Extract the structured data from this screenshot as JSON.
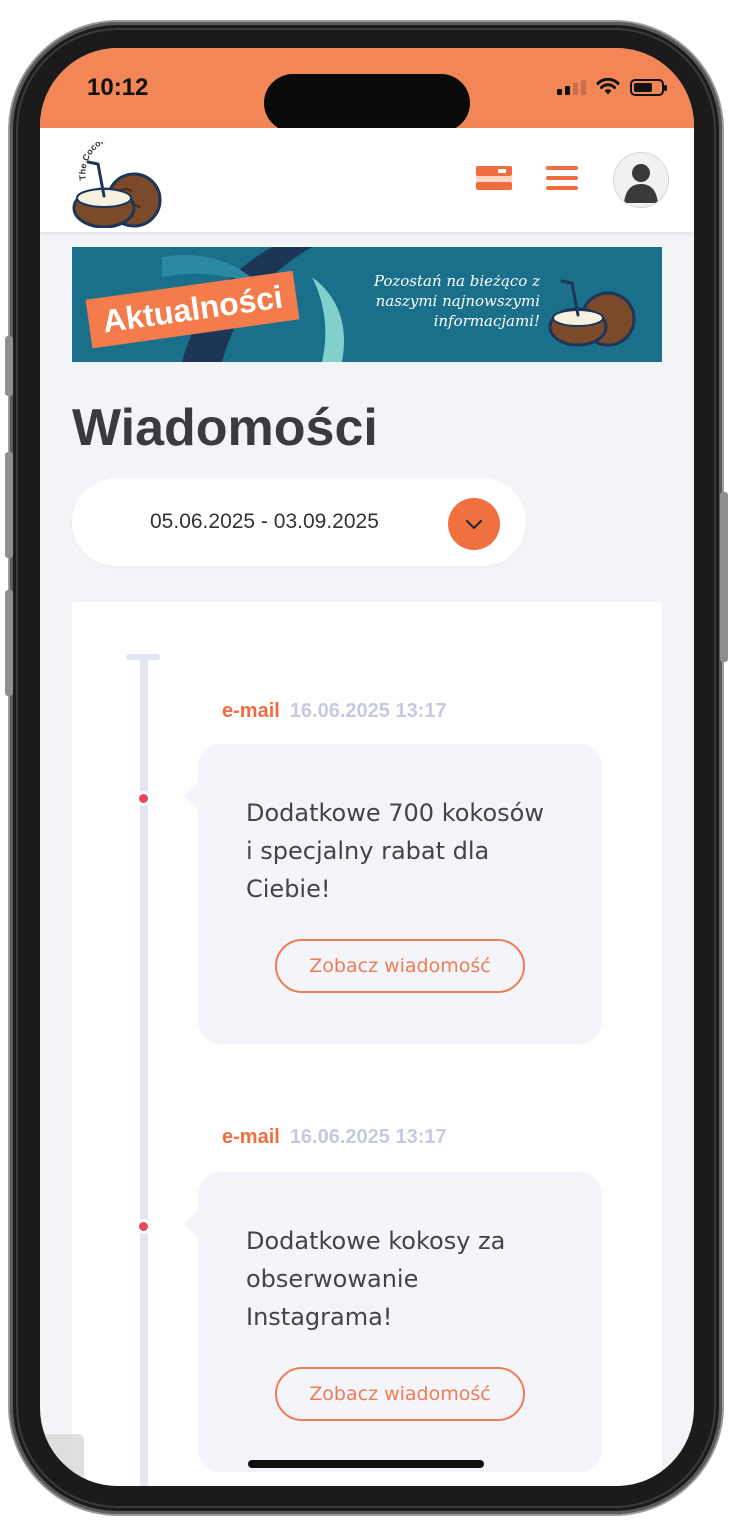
{
  "status_bar": {
    "time": "10:12",
    "accent_color": "#f38657"
  },
  "header": {
    "logo_text": "The Coconut Club",
    "icons": [
      "card-icon",
      "menu-icon",
      "user-avatar-icon"
    ]
  },
  "banner": {
    "tag": "Aktualności",
    "text": "Pozostań na bieżąco z naszymi najnowszymi informacjami!",
    "logo_text": "The Coconut Club"
  },
  "page": {
    "title": "Wiadomości"
  },
  "date_filter": {
    "range": "05.06.2025 - 03.09.2025"
  },
  "messages": [
    {
      "channel": "e-mail",
      "datetime": "16.06.2025 13:17",
      "title": "Dodatkowe 700 kokosów i specjalny rabat dla Ciebie!",
      "button": "Zobacz wiadomość"
    },
    {
      "channel": "e-mail",
      "datetime": "16.06.2025 13:17",
      "title": "Dodatkowe kokosy za obserwowanie Instagrama!",
      "button": "Zobacz wiadomość"
    }
  ],
  "colors": {
    "accent": "#f26d3d",
    "timeline_dot": "#e8475b",
    "page_bg": "#f3f4f8"
  }
}
